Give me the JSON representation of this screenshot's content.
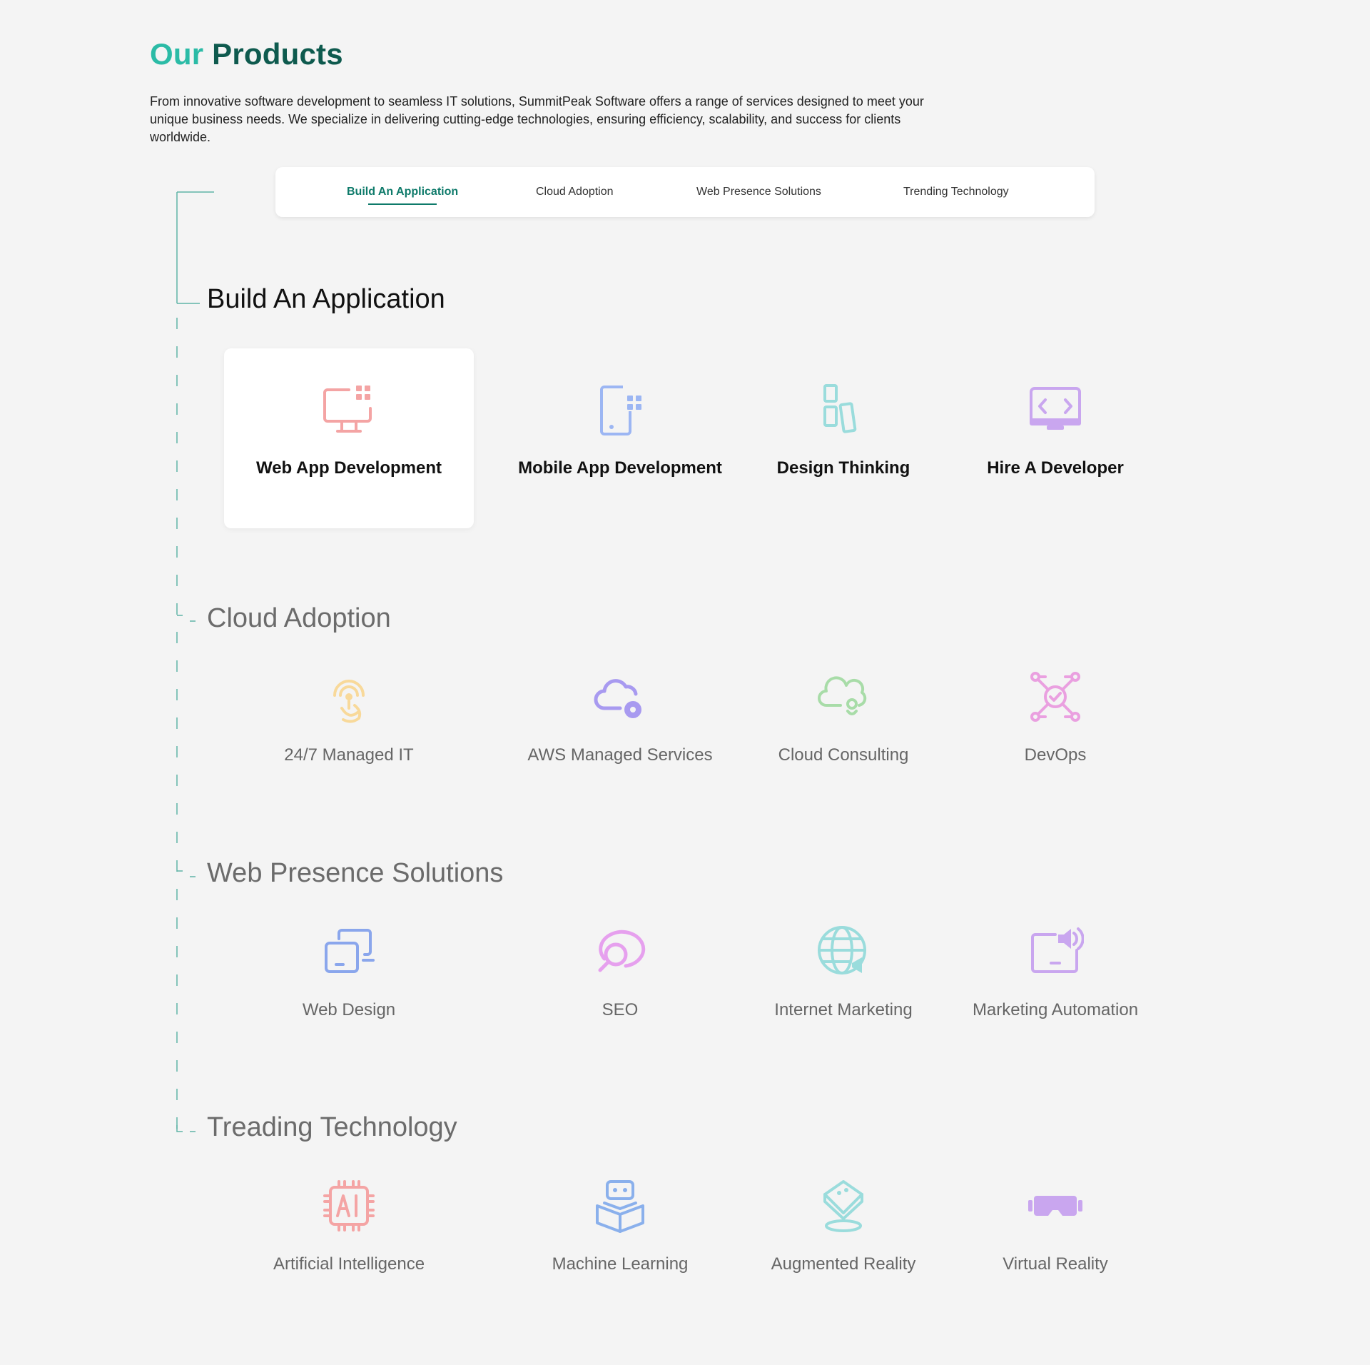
{
  "header": {
    "title_part1": "Our",
    "title_part2": "Products",
    "intro": "From innovative software development to seamless IT solutions, SummitPeak Software offers a range of services designed to meet your unique business needs. We specialize in delivering cutting-edge technologies, ensuring efficiency, scalability, and success for clients worldwide."
  },
  "tabs": [
    {
      "label": "Build An Application",
      "active": true
    },
    {
      "label": "Cloud Adoption",
      "active": false
    },
    {
      "label": "Web Presence Solutions",
      "active": false
    },
    {
      "label": "Trending Technology",
      "active": false
    }
  ],
  "colors": {
    "accent": "#0e7a6a",
    "accent_light": "#2bbba6",
    "tree_line": "#5fb3a6"
  },
  "sections": [
    {
      "title": "Build An Application",
      "items": [
        {
          "label": "Web App Development",
          "icon": "monitor-grid-icon",
          "color": "#f4a4a4",
          "selected": true
        },
        {
          "label": "Mobile App Development",
          "icon": "mobile-grid-icon",
          "color": "#9cb6f3",
          "selected": false
        },
        {
          "label": "Design Thinking",
          "icon": "layout-blocks-icon",
          "color": "#9adcdc",
          "selected": false
        },
        {
          "label": "Hire A Developer",
          "icon": "code-monitor-icon",
          "color": "#c9a6ef",
          "selected": false
        }
      ]
    },
    {
      "title": "Cloud Adoption",
      "items": [
        {
          "label": "24/7 Managed IT",
          "icon": "support-headset-icon",
          "color": "#f8d99a"
        },
        {
          "label": "AWS Managed Services",
          "icon": "cloud-gear-icon",
          "color": "#a89af0"
        },
        {
          "label": "Cloud Consulting",
          "icon": "cloud-consulting-icon",
          "color": "#a8dca8"
        },
        {
          "label": "DevOps",
          "icon": "devops-network-icon",
          "color": "#eaa0e0"
        }
      ]
    },
    {
      "title": "Web Presence Solutions",
      "items": [
        {
          "label": "Web Design",
          "icon": "web-design-icon",
          "color": "#8aa6ec"
        },
        {
          "label": "SEO",
          "icon": "seo-search-icon",
          "color": "#e6a0ee"
        },
        {
          "label": "Internet Marketing",
          "icon": "globe-megaphone-icon",
          "color": "#9adcdc"
        },
        {
          "label": "Marketing Automation",
          "icon": "screen-speaker-icon",
          "color": "#c9a6ef"
        }
      ]
    },
    {
      "title": "Treading Technology",
      "items": [
        {
          "label": "Artificial Intelligence",
          "icon": "ai-chip-icon",
          "color": "#f4a4a4"
        },
        {
          "label": "Machine Learning",
          "icon": "robot-book-icon",
          "color": "#8ab0ec"
        },
        {
          "label": "Augmented Reality",
          "icon": "ar-cube-icon",
          "color": "#9adcdc"
        },
        {
          "label": "Virtual Reality",
          "icon": "vr-headset-icon",
          "color": "#c9a6ef"
        }
      ]
    }
  ]
}
